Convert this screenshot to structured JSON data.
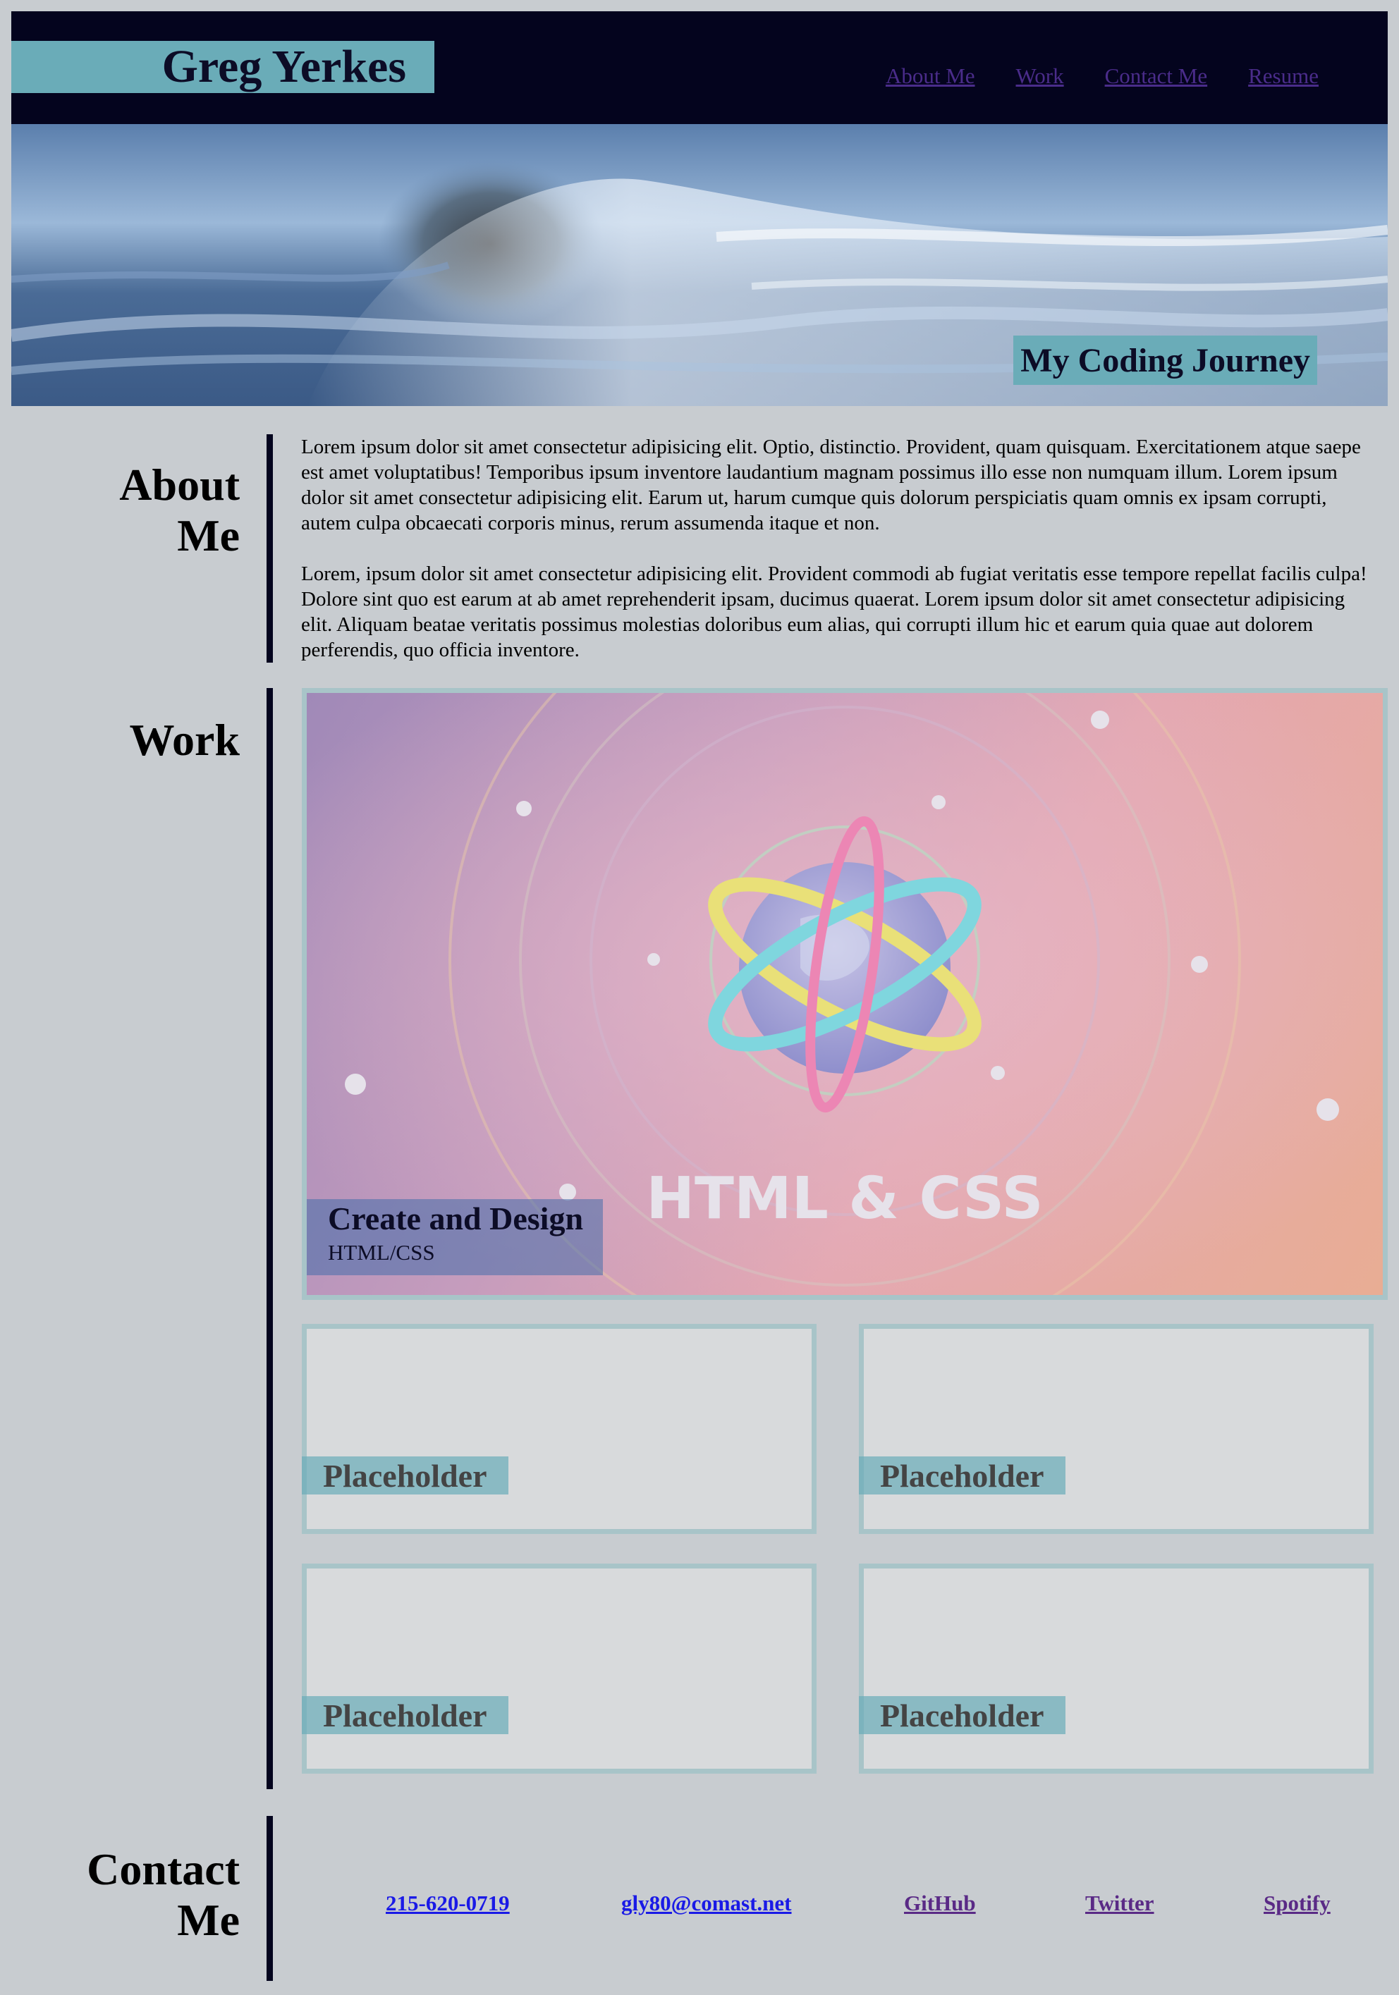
{
  "header": {
    "brand": "Greg Yerkes",
    "nav": [
      {
        "label": "About Me"
      },
      {
        "label": "Work"
      },
      {
        "label": "Contact Me"
      },
      {
        "label": "Resume"
      }
    ]
  },
  "hero": {
    "badge": "My Coding Journey"
  },
  "about": {
    "title_line1": "About",
    "title_line2": "Me",
    "paragraphs": [
      "Lorem ipsum dolor sit amet consectetur adipisicing elit. Optio, distinctio. Provident, quam quisquam. Exercitationem atque saepe est amet voluptatibus! Temporibus ipsum inventore laudantium magnam possimus illo esse non numquam illum. Lorem ipsum dolor sit amet consectetur adipisicing elit. Earum ut, harum cumque quis dolorum perspiciatis quam omnis ex ipsam corrupti, autem culpa obcaecati corporis minus, rerum assumenda itaque et non.",
      "Lorem, ipsum dolor sit amet consectetur adipisicing elit. Provident commodi ab fugiat veritatis esse tempore repellat facilis culpa! Dolore sint quo est earum at ab amet reprehenderit ipsam, ducimus quaerat. Lorem ipsum dolor sit amet consectetur adipisicing elit. Aliquam beatae veritatis possimus molestias doloribus eum alias, qui corrupti illum hic et earum quia quae aut dolorem perferendis, quo officia inventore."
    ]
  },
  "work": {
    "title": "Work",
    "featured": {
      "image_text": "HTML & CSS",
      "title": "Create and Design",
      "subtitle": "HTML/CSS"
    },
    "cards": [
      {
        "label": "Placeholder"
      },
      {
        "label": "Placeholder"
      },
      {
        "label": "Placeholder"
      },
      {
        "label": "Placeholder"
      }
    ]
  },
  "contact": {
    "title_line1": "Contact",
    "title_line2": "Me",
    "links": [
      {
        "label": "215-620-0719"
      },
      {
        "label": "gly80@comast.net"
      },
      {
        "label": "GitHub"
      },
      {
        "label": "Twitter"
      },
      {
        "label": "Spotify"
      }
    ]
  },
  "colors": {
    "background": "#c8ccd0",
    "header": "#04041e",
    "accent_teal": "#6aacb8",
    "nav_link": "#4a2c8a"
  }
}
